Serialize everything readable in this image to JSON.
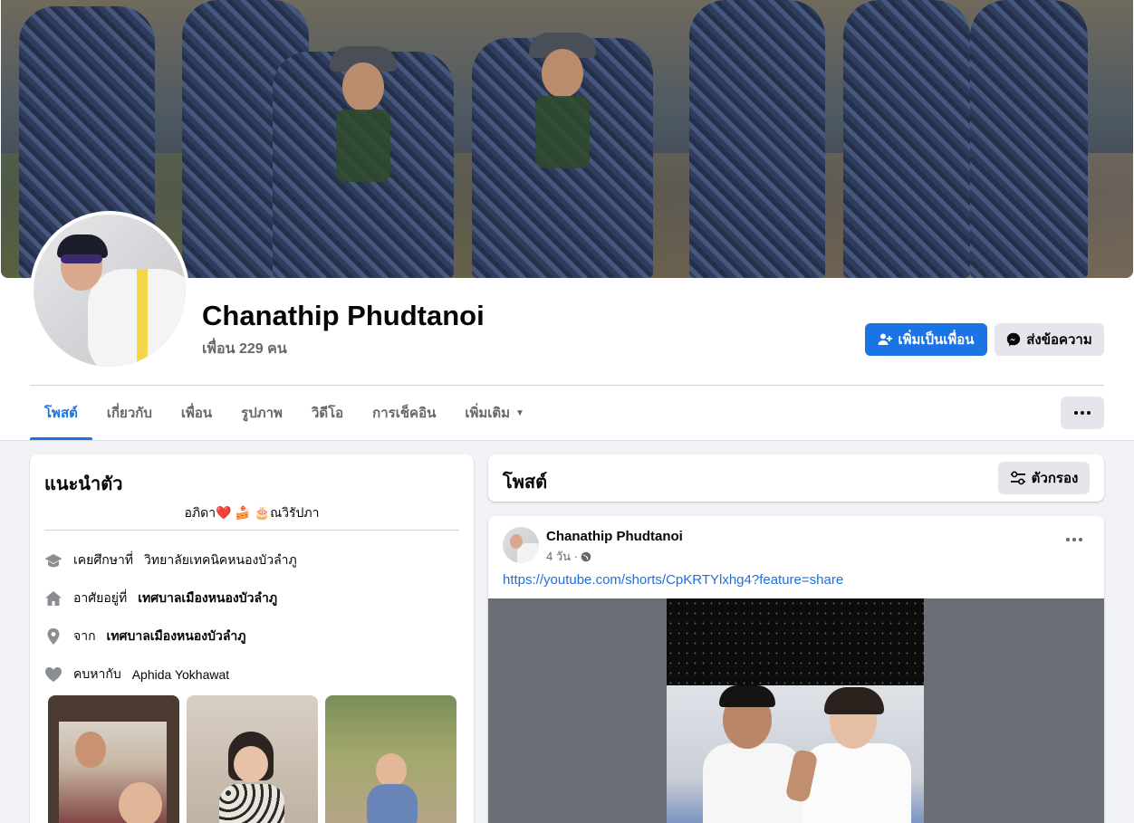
{
  "profile": {
    "name": "Chanathip Phudtanoi",
    "friends": "เพื่อน 229 คน"
  },
  "actions": {
    "add_friend": "เพิ่มเป็นเพื่อน",
    "message": "ส่งข้อความ"
  },
  "tabs": [
    {
      "label": "โพสต์",
      "active": true
    },
    {
      "label": "เกี่ยวกับ"
    },
    {
      "label": "เพื่อน"
    },
    {
      "label": "รูปภาพ"
    },
    {
      "label": "วิดีโอ"
    },
    {
      "label": "การเช็คอิน"
    },
    {
      "label": "เพิ่มเติม"
    }
  ],
  "intro": {
    "title": "แนะนำตัว",
    "bio": "อภิดา❤️ 🍰 🎂ณวิรัปภา",
    "studied_prefix": "เคยศึกษาที่",
    "studied_at": "วิทยาลัยเทคนิคหนองบัวลำภู",
    "lives_prefix": "อาศัยอยู่ที่",
    "lives_in": "เทศบาลเมืองหนองบัวลำภู",
    "from_prefix": "จาก",
    "from": "เทศบาลเมืองหนองบัวลำภู",
    "relationship_prefix": "คบหากับ",
    "relationship_with": "Aphida Yokhawat"
  },
  "posts": {
    "title": "โพสต์",
    "filter_label": "ตัวกรอง"
  },
  "post": {
    "author": "Chanathip Phudtanoi",
    "time": "4 วัน ·",
    "link": "https://youtube.com/shorts/CpKRTYlxhg4?feature=share"
  },
  "colors": {
    "primary": "#1b74e4",
    "link": "#216fdb",
    "secondary_button": "#e4e6eb",
    "muted_text": "#65676b",
    "page_bg": "#f0f2f5"
  },
  "icons": {
    "add_friend": "person-plus-icon",
    "message": "messenger-icon",
    "filter": "sliders-icon",
    "education": "graduation-cap-icon",
    "home": "house-icon",
    "location": "map-pin-icon",
    "relationship": "heart-icon",
    "privacy": "globe-icon"
  }
}
